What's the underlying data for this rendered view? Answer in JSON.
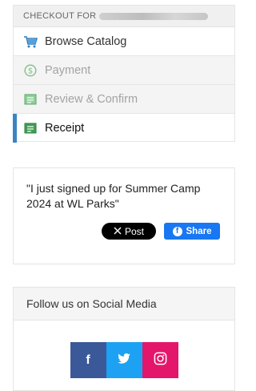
{
  "checkout": {
    "header_label": "CHECKOUT FOR",
    "steps": [
      {
        "label": "Browse Catalog",
        "icon": "cart-icon",
        "state": "completed"
      },
      {
        "label": "Payment",
        "icon": "dollar-circle-icon",
        "state": "disabled"
      },
      {
        "label": "Review & Confirm",
        "icon": "receipt-icon",
        "state": "disabled"
      },
      {
        "label": "Receipt",
        "icon": "receipt-icon",
        "state": "current"
      }
    ]
  },
  "share": {
    "quote": "\"I just signed up for Summer Camp 2024 at WL Parks\"",
    "x_label": "Post",
    "facebook_label": "Share"
  },
  "social": {
    "title": "Follow us on Social Media",
    "facebook_letter": "f"
  },
  "colors": {
    "accent": "#3a84c4",
    "facebook": "#3b5998",
    "twitter": "#1da1f2",
    "instagram": "#e4166b",
    "fb_share": "#1877f2"
  }
}
